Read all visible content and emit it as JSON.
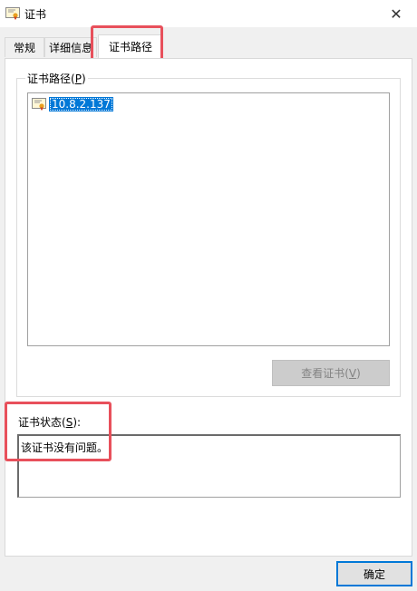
{
  "window": {
    "title": "证书",
    "close_glyph": "✕"
  },
  "tabs": [
    {
      "label": "常规"
    },
    {
      "label": "详细信息"
    },
    {
      "label": "证书路径",
      "selected": true
    }
  ],
  "cert_path": {
    "group_label_text": "证书路径(",
    "group_label_key": "P",
    "group_label_end": ")",
    "tree_items": [
      {
        "label": "10.8.2.137",
        "icon": "certificate-icon",
        "selected": true
      }
    ],
    "view_button_text": "查看证书(",
    "view_button_key": "V",
    "view_button_end": ")"
  },
  "status": {
    "label_text": "证书状态(",
    "label_key": "S",
    "label_end": "):",
    "value": "该证书没有问题。"
  },
  "footer": {
    "ok_label": "确定"
  },
  "colors": {
    "accent": "#0078d7",
    "highlight": "#e8505b"
  }
}
